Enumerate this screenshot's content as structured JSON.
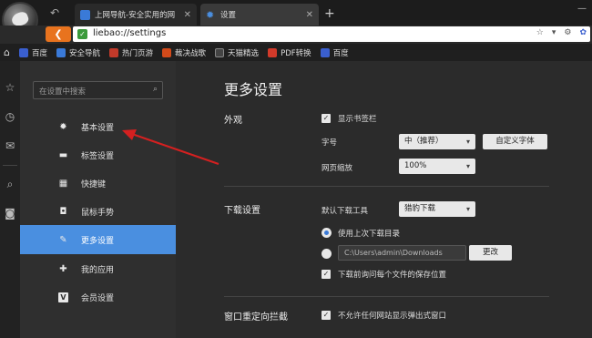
{
  "tabs": [
    {
      "title": "上网导航-安全实用的网",
      "favicon_color": "#3a7ad8",
      "active": false
    },
    {
      "title": "设置",
      "favicon_color": "#4a8fe0",
      "active": true
    }
  ],
  "address": {
    "url": "liebao://settings"
  },
  "bookmarks": [
    {
      "label": "百度",
      "color": "#3a5fcf"
    },
    {
      "label": "安全导航",
      "color": "#3a7ad8"
    },
    {
      "label": "热门页游",
      "color": "#c23a2a"
    },
    {
      "label": "裁决战歌",
      "color": "#d24a1a"
    },
    {
      "label": "天猫精选",
      "color": "#444"
    },
    {
      "label": "PDF转换",
      "color": "#d23a2a"
    },
    {
      "label": "百度",
      "color": "#3a5fcf"
    }
  ],
  "sidebar": {
    "search_placeholder": "在设置中搜索",
    "items": [
      {
        "label": "基本设置",
        "icon": "gear-icon",
        "glyph": "✹",
        "active": false
      },
      {
        "label": "标签设置",
        "icon": "laptop-icon",
        "glyph": "▬",
        "active": false
      },
      {
        "label": "快捷键",
        "icon": "keyboard-icon",
        "glyph": "▦",
        "active": false
      },
      {
        "label": "鼠标手势",
        "icon": "mouse-icon",
        "glyph": "◘",
        "active": false
      },
      {
        "label": "更多设置",
        "icon": "wrench-icon",
        "glyph": "✎",
        "active": true
      },
      {
        "label": "我的应用",
        "icon": "puzzle-icon",
        "glyph": "✚",
        "active": false
      },
      {
        "label": "会员设置",
        "icon": "vip-icon",
        "glyph": "V",
        "active": false
      }
    ]
  },
  "main": {
    "title": "更多设置",
    "appearance": {
      "section": "外观",
      "show_bookmarks_bar": "显示书签栏",
      "font_label": "字号",
      "font_value": "中（推荐）",
      "custom_font_button": "自定义字体",
      "zoom_label": "网页缩放",
      "zoom_value": "100%"
    },
    "download": {
      "section": "下载设置",
      "default_tool_label": "默认下载工具",
      "default_tool_value": "猎豹下载",
      "use_last_dir": "使用上次下载目录",
      "path_value": "C:\\Users\\admin\\Downloads",
      "change_button": "更改",
      "ask_each_file": "下载前询问每个文件的保存位置"
    },
    "popup": {
      "section": "窗口重定向拦截",
      "block_popups": "不允许任何网站显示弹出式窗口"
    }
  },
  "colors": {
    "accent": "#4a8fe0",
    "annotation_arrow": "#d42020"
  }
}
